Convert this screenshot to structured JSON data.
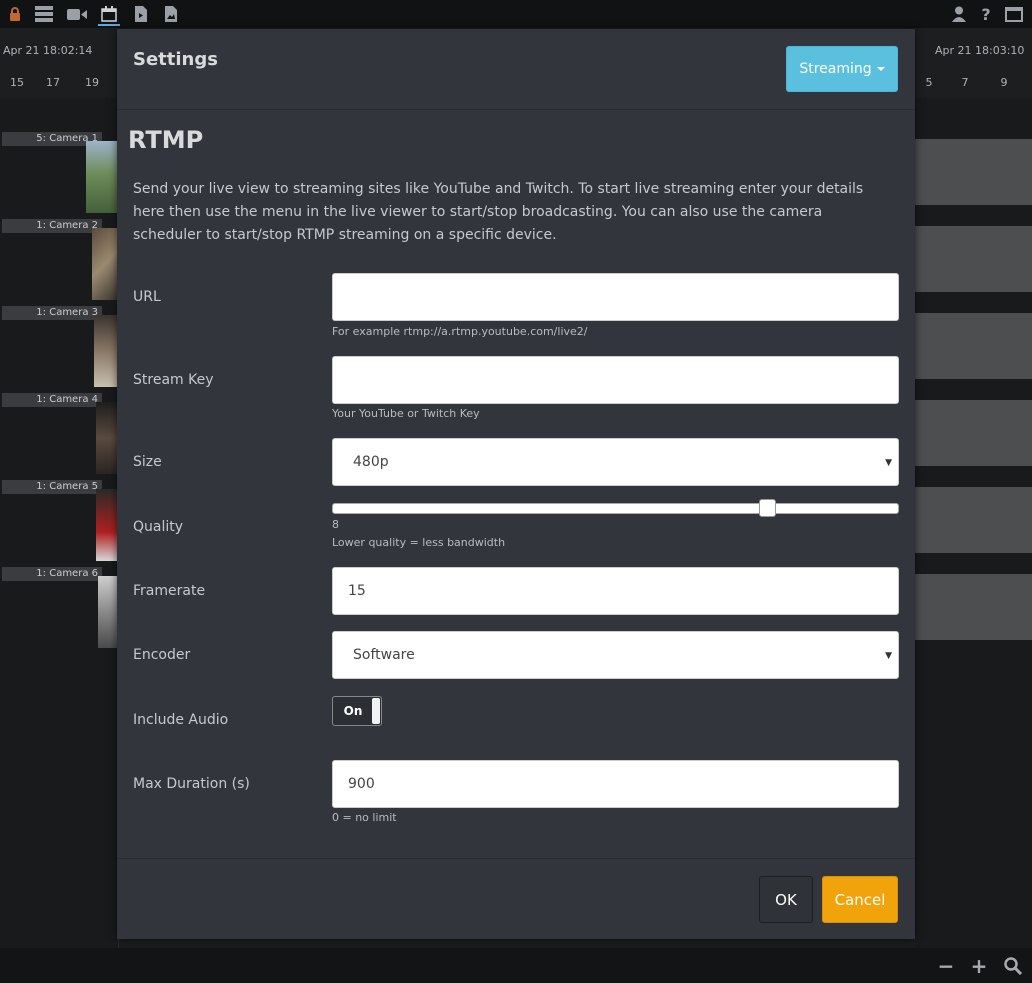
{
  "toolbar": {
    "icons": [
      "lock-icon",
      "server-icon",
      "video-camera-icon",
      "calendar-icon",
      "video-file-icon",
      "image-icon"
    ],
    "right_icons": [
      "user-icon",
      "help-icon",
      "window-icon"
    ],
    "help_glyph": "?"
  },
  "timeline": {
    "start_time": "Apr 21 18:02:14",
    "end_time": "Apr 21 18:03:10",
    "left_ticks": [
      "15",
      "17",
      "19"
    ],
    "right_ticks": [
      "5",
      "7",
      "9"
    ]
  },
  "cameras": [
    {
      "label": "5: Camera 1"
    },
    {
      "label": "1: Camera 2"
    },
    {
      "label": "1: Camera 3"
    },
    {
      "label": "1: Camera 4"
    },
    {
      "label": "1: Camera 5"
    },
    {
      "label": "1: Camera 6"
    }
  ],
  "bottom": {
    "minus": "−",
    "plus": "+",
    "search_icon": "search-icon"
  },
  "modal": {
    "title": "Settings",
    "streaming_button": "Streaming",
    "section_title": "RTMP",
    "description": "Send your live view to streaming sites like YouTube and Twitch. To start live streaming enter your details here then use the menu in the live viewer to start/stop broadcasting. You can also use the camera scheduler to start/stop RTMP streaming on a specific device.",
    "fields": {
      "url": {
        "label": "URL",
        "value": "",
        "help": "For example rtmp://a.rtmp.youtube.com/live2/"
      },
      "stream_key": {
        "label": "Stream Key",
        "value": "",
        "help": "Your YouTube or Twitch Key"
      },
      "size": {
        "label": "Size",
        "selected": "480p"
      },
      "quality": {
        "label": "Quality",
        "value": "8",
        "min": 1,
        "max": 10,
        "help": "Lower quality = less bandwidth"
      },
      "framerate": {
        "label": "Framerate",
        "value": "15"
      },
      "encoder": {
        "label": "Encoder",
        "selected": "Software"
      },
      "include_audio": {
        "label": "Include Audio",
        "state": "On"
      },
      "max_duration": {
        "label": "Max Duration (s)",
        "value": "900",
        "help": "0 = no limit"
      }
    },
    "ok_button": "OK",
    "cancel_button": "Cancel"
  },
  "colors": {
    "accent_info": "#5bc0de",
    "cancel": "#f0a30a",
    "modal_bg": "#32363c",
    "page_bg": "#1b1c1e"
  }
}
